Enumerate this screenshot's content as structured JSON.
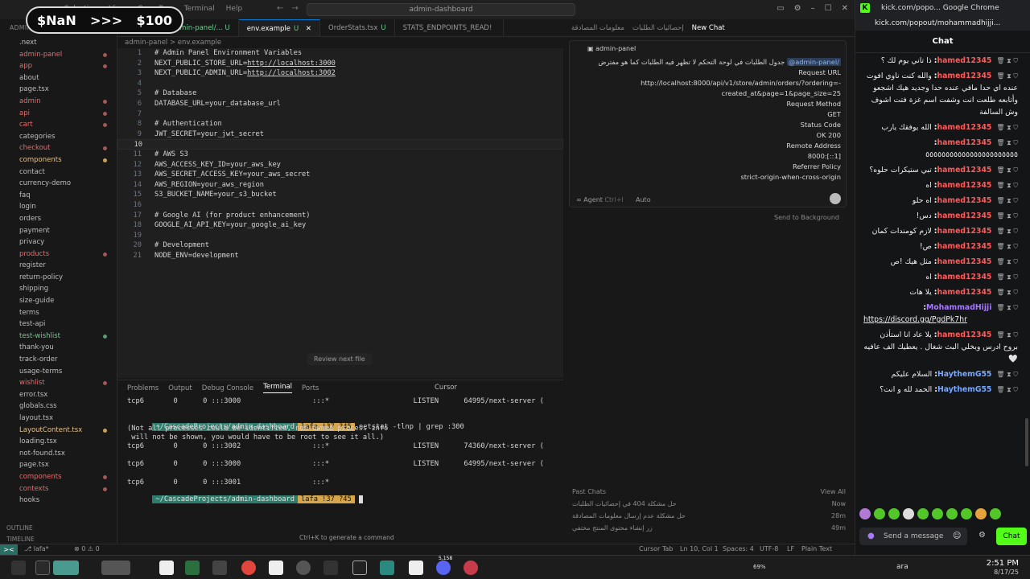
{
  "promo": {
    "label": "$NaN",
    "arrow": ">>>",
    "amount": "$100"
  },
  "titlebar": {
    "menu": [
      "Selection",
      "View",
      "Go",
      "Run",
      "Terminal",
      "Help"
    ],
    "search": "admin-dashboard"
  },
  "explorer": {
    "header": "ADMIN-DASHBOARD",
    "items": [
      {
        "label": ".next",
        "cls": ""
      },
      {
        "label": "admin-panel",
        "cls": "red"
      },
      {
        "label": "app",
        "cls": "red"
      },
      {
        "label": "about",
        "cls": ""
      },
      {
        "label": "page.tsx",
        "cls": ""
      },
      {
        "label": "admin",
        "cls": "red"
      },
      {
        "label": "api",
        "cls": "red"
      },
      {
        "label": "cart",
        "cls": "red"
      },
      {
        "label": "categories",
        "cls": ""
      },
      {
        "label": "checkout",
        "cls": "red"
      },
      {
        "label": "components",
        "cls": "yellow"
      },
      {
        "label": "contact",
        "cls": ""
      },
      {
        "label": "currency-demo",
        "cls": ""
      },
      {
        "label": "faq",
        "cls": ""
      },
      {
        "label": "login",
        "cls": ""
      },
      {
        "label": "orders",
        "cls": ""
      },
      {
        "label": "payment",
        "cls": ""
      },
      {
        "label": "privacy",
        "cls": ""
      },
      {
        "label": "products",
        "cls": "red"
      },
      {
        "label": "register",
        "cls": ""
      },
      {
        "label": "return-policy",
        "cls": ""
      },
      {
        "label": "shipping",
        "cls": ""
      },
      {
        "label": "size-guide",
        "cls": ""
      },
      {
        "label": "terms",
        "cls": ""
      },
      {
        "label": "test-api",
        "cls": ""
      },
      {
        "label": "test-wishlist",
        "cls": "teal"
      },
      {
        "label": "thank-you",
        "cls": ""
      },
      {
        "label": "track-order",
        "cls": ""
      },
      {
        "label": "usage-terms",
        "cls": ""
      },
      {
        "label": "wishlist",
        "cls": "red"
      },
      {
        "label": "error.tsx",
        "cls": ""
      },
      {
        "label": "globals.css",
        "cls": ""
      },
      {
        "label": "layout.tsx",
        "cls": ""
      },
      {
        "label": "LayoutContent.tsx",
        "cls": "yellow"
      },
      {
        "label": "loading.tsx",
        "cls": ""
      },
      {
        "label": "not-found.tsx",
        "cls": ""
      },
      {
        "label": "page.tsx",
        "cls": ""
      },
      {
        "label": "components",
        "cls": "red"
      },
      {
        "label": "contexts",
        "cls": "red"
      },
      {
        "label": "hooks",
        "cls": ""
      }
    ],
    "outline": "OUTLINE",
    "timeline": "TIMELINE"
  },
  "tabs": [
    {
      "label": "OrdersAPI.ts",
      "suffix": "admin-panel/... U",
      "active": false
    },
    {
      "label": "env.example",
      "suffix": "U",
      "active": true
    },
    {
      "label": "OrderStats.tsx",
      "suffix": "U",
      "active": false
    },
    {
      "label": "STATS_ENDPOINTS_READ!",
      "suffix": "",
      "active": false
    }
  ],
  "breadcrumb": "admin-panel  >  env.example",
  "code": [
    {
      "n": "1",
      "t": "# Admin Panel Environment Variables"
    },
    {
      "n": "2",
      "t": "NEXT_PUBLIC_STORE_URL=",
      "url": "http://localhost:3000"
    },
    {
      "n": "3",
      "t": "NEXT_PUBLIC_ADMIN_URL=",
      "url": "http://localhost:3002"
    },
    {
      "n": "4",
      "t": ""
    },
    {
      "n": "5",
      "t": "# Database"
    },
    {
      "n": "6",
      "t": "DATABASE_URL=your_database_url"
    },
    {
      "n": "7",
      "t": ""
    },
    {
      "n": "8",
      "t": "# Authentication"
    },
    {
      "n": "9",
      "t": "JWT_SECRET=your_jwt_secret"
    },
    {
      "n": "10",
      "t": "",
      "cur": true
    },
    {
      "n": "11",
      "t": "# AWS S3"
    },
    {
      "n": "12",
      "t": "AWS_ACCESS_KEY_ID=your_aws_key"
    },
    {
      "n": "13",
      "t": "AWS_SECRET_ACCESS_KEY=your_aws_secret"
    },
    {
      "n": "14",
      "t": "AWS_REGION=your_aws_region"
    },
    {
      "n": "15",
      "t": "S3_BUCKET_NAME=your_s3_bucket"
    },
    {
      "n": "16",
      "t": ""
    },
    {
      "n": "17",
      "t": "# Google AI (for product enhancement)"
    },
    {
      "n": "18",
      "t": "GOOGLE_AI_API_KEY=your_google_ai_key"
    },
    {
      "n": "19",
      "t": ""
    },
    {
      "n": "20",
      "t": "# Development"
    },
    {
      "n": "21",
      "t": "NODE_ENV=development"
    }
  ],
  "review_next": "Review next file",
  "panel": {
    "tabs": [
      "Problems",
      "Output",
      "Debug Console",
      "Terminal",
      "Ports"
    ],
    "active": "Terminal",
    "shell": "Cursor"
  },
  "terminal": {
    "l1": "tcp6       0      0 :::3000                 :::*                    LISTEN      64995/next-server (",
    "prompt_path": "~/CascadeProjects/admin-dashboard",
    "prompt_git": "lafa !37 ?45",
    "command": "netstat -tlnp | grep :300",
    "l3": "(Not all processes could be identified, non-owned process info",
    "l4": " will not be shown, you would have to be root to see it all.)",
    "l5": "tcp6       0      0 :::3002                 :::*                    LISTEN      74360/next-server (",
    "l6": "tcp6       0      0 :::3000                 :::*                    LISTEN      64995/next-server (",
    "l7": "tcp6       0      0 :::3001                 :::*"
  },
  "ctrlk": "Ctrl+K to generate a command",
  "chat": {
    "tabs": [
      "معلومات المصادقة",
      "إحصائيات الطلبات",
      "New Chat"
    ],
    "active": "New Chat",
    "context_chip": "admin-panel",
    "mention": "@admin-panel/",
    "line0": "جدول الطلبات في لوحة التحكم لا تظهر فيه الطلبات كما هو مفترض",
    "lines": [
      "Request URL",
      "http://localhost:8000/api/v1/store/admin/orders/?ordering=-",
      "created_at&page=1&page_size=25",
      "Request Method",
      "GET",
      "Status Code",
      "OK 200",
      "Remote Address",
      "8000:[::1]",
      "Referrer Policy",
      "strict-origin-when-cross-origin"
    ],
    "agent": "Agent",
    "agent_shortcut": "Ctrl+I",
    "model": "Auto",
    "send_bg": "Send to Background",
    "past_title": "Past Chats",
    "view_all": "View All",
    "past": [
      {
        "label": "حل مشكلة 404 في إحصائيات الطلبات",
        "time": "Now"
      },
      {
        "label": "حل مشكلة عدم إرسال معلومات المصادقة",
        "time": "28m"
      },
      {
        "label": "زر إنشاء محتوى المنتج مختفي",
        "time": "49m"
      }
    ]
  },
  "status": {
    "remote": "><",
    "branch": "lafa*",
    "errors": "0",
    "warnings": "0",
    "cursor_tab": "Cursor Tab",
    "position": "Ln 10, Col 1",
    "spaces": "Spaces: 4",
    "encoding": "UTF-8",
    "eol": "LF",
    "lang": "Plain Text"
  },
  "taskbar": {
    "time": "2:51 PM",
    "date": "8/17/25",
    "lang": "ara",
    "battery": "69%",
    "discord_badge": "5,158"
  },
  "kick": {
    "title": "kick.com/popo... Google Chrome",
    "url": "kick.com/popout/mohammadhijji...",
    "header": "Chat",
    "messages": [
      {
        "user": "hamed12345",
        "text": "ذا تاني يوم لك ؟",
        "color": "red"
      },
      {
        "user": "hamed12345",
        "text": "والله كنت ناوي افوت عنده اي حدا مافي عنده حدا وجديد هيك اشجعو وأتابعه طلعت انت وشفت اسم غزة فتت اشوف وش السالفة",
        "color": "red"
      },
      {
        "user": "hamed12345",
        "text": "الله يوفقك يارب",
        "color": "red"
      },
      {
        "user": "hamed12345",
        "text": "٥٥٥٥٥٥٥٥٥٥٥٥٥٥٥٥٥٥٥٥٥٥٥",
        "color": "red"
      },
      {
        "user": "hamed12345",
        "text": "تبي ستيكرات حلوه؟",
        "color": "red"
      },
      {
        "user": "hamed12345",
        "text": "اه",
        "color": "red"
      },
      {
        "user": "hamed12345",
        "text": "اه حلو",
        "color": "red"
      },
      {
        "user": "hamed12345",
        "text": "دس!",
        "color": "red"
      },
      {
        "user": "hamed12345",
        "text": "لازم كومندات كمان",
        "color": "red"
      },
      {
        "user": "hamed12345",
        "text": "ص!",
        "color": "red"
      },
      {
        "user": "hamed12345",
        "text": "مثل هيك !ص",
        "color": "red"
      },
      {
        "user": "hamed12345",
        "text": "اه",
        "color": "red"
      },
      {
        "user": "hamed12345",
        "text": "يلا هات",
        "color": "red"
      },
      {
        "user": "MohammadHijji",
        "text": "https://discord.gg/PgdPk7hr",
        "color": "purple",
        "link": true
      },
      {
        "user": "hamed12345",
        "text": "يلا عاد انا استأذن بروح ادرس وبخلي البث شغال . يعطيك الف عافيه 🤍",
        "color": "red"
      },
      {
        "user": "HaythemG55",
        "text": "السلام عليكم",
        "color": "blue"
      },
      {
        "user": "HaythemG55",
        "text": "الحمد لله و انت؟",
        "color": "blue"
      }
    ],
    "placeholder": "Send a message",
    "chat_button": "Chat"
  }
}
